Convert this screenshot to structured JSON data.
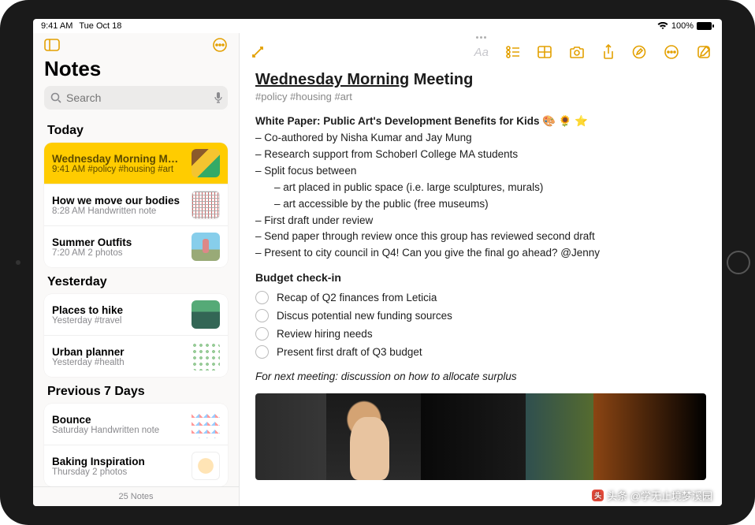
{
  "status": {
    "time": "9:41 AM",
    "date": "Tue Oct 18",
    "battery": "100%"
  },
  "sidebar": {
    "title": "Notes",
    "search_placeholder": "Search",
    "footer": "25 Notes",
    "sections": [
      {
        "header": "Today",
        "items": [
          {
            "title": "Wednesday Morning Meeting",
            "meta": "9:41 AM  #policy #housing #art",
            "thumb": "t1",
            "selected": true
          },
          {
            "title": "How we move our bodies",
            "meta": "8:28 AM  Handwritten note",
            "thumb": "t2"
          },
          {
            "title": "Summer Outfits",
            "meta": "7:20 AM  2 photos",
            "thumb": "t3"
          }
        ]
      },
      {
        "header": "Yesterday",
        "items": [
          {
            "title": "Places to hike",
            "meta": "Yesterday  #travel",
            "thumb": "t4"
          },
          {
            "title": "Urban planner",
            "meta": "Yesterday  #health",
            "thumb": "t5"
          }
        ]
      },
      {
        "header": "Previous 7 Days",
        "items": [
          {
            "title": "Bounce",
            "meta": "Saturday  Handwritten note",
            "thumb": "t6"
          },
          {
            "title": "Baking Inspiration",
            "meta": "Thursday  2 photos",
            "thumb": "t7"
          }
        ]
      }
    ]
  },
  "note": {
    "title_u": "Wednesday Morning",
    "title_rest": " Meeting",
    "tags": "#policy #housing #art",
    "wp_label": "White Paper: Public Art's Development Benefits for Kids 🎨 🌻 ⭐",
    "lines": [
      "– Co-authored by Nisha Kumar and Jay Mung",
      "– Research support from Schoberl College MA students",
      "– Split focus between"
    ],
    "sub_lines": [
      "– art placed in public space (i.e. large sculptures, murals)",
      "– art accessible by the public (free museums)"
    ],
    "lines2": [
      "– First draft under review",
      "– Send paper through review once this group has reviewed second draft",
      "– Present to city council in Q4! Can you give the final go ahead? @Jenny"
    ],
    "budget_h": "Budget check-in",
    "checklist": [
      "Recap of Q2 finances from Leticia",
      "Discus potential new funding sources",
      "Review hiring needs",
      "Present first draft of Q3 budget"
    ],
    "next": "For next meeting: discussion on how to allocate surplus"
  },
  "watermark": {
    "logo": "头",
    "text": "头条 @学无止境梦溪园"
  }
}
